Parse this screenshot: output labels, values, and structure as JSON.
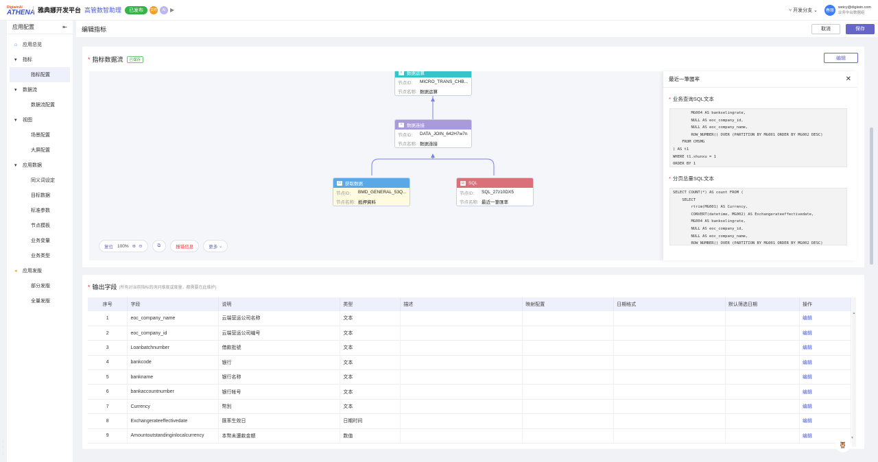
{
  "topbar": {
    "logo_main": "ATHENA",
    "logo_small": "DigiwinAI",
    "platform": "雅典娜开发平台",
    "app_name": "高管数智助理",
    "status": "已发布",
    "av1": "文件",
    "av2": "AI",
    "branch": "开发分支",
    "avatar": "春丽",
    "user_email": "weicy@digiwin.com",
    "user_org": "业务中台数据组"
  },
  "sidebar": {
    "title": "应用配置",
    "items": [
      {
        "label": "应用总览",
        "icon": "home-icon",
        "type": "top",
        "glyph": "⌂"
      },
      {
        "label": "指标",
        "type": "group",
        "glyph": "▾"
      },
      {
        "label": "指标配置",
        "type": "sub",
        "selected": true
      },
      {
        "label": "数据流",
        "type": "group",
        "glyph": "▾"
      },
      {
        "label": "数据流配置",
        "type": "sub"
      },
      {
        "label": "视图",
        "type": "group",
        "glyph": "▾"
      },
      {
        "label": "场景配置",
        "type": "sub"
      },
      {
        "label": "大屏配置",
        "type": "sub"
      },
      {
        "label": "应用数据",
        "type": "group",
        "glyph": "▾"
      },
      {
        "label": "同义词设定",
        "type": "sub"
      },
      {
        "label": "目标数据",
        "type": "sub"
      },
      {
        "label": "标准参数",
        "type": "sub"
      },
      {
        "label": "节点模板",
        "type": "sub"
      },
      {
        "label": "业务变量",
        "type": "sub"
      },
      {
        "label": "业务类型",
        "type": "sub"
      },
      {
        "label": "应用发版",
        "type": "group",
        "glyph": "◂"
      },
      {
        "label": "部分发版",
        "type": "sub"
      },
      {
        "label": "全量发版",
        "type": "sub"
      }
    ]
  },
  "header": {
    "title": "编辑指标",
    "cancel": "取消",
    "save": "保存"
  },
  "flow": {
    "title": "指标数据流",
    "tag": "已保存",
    "edit": "编辑",
    "k_id": "节点ID:",
    "k_name": "节点名称:",
    "nodes": [
      {
        "id": "MICRO_TRANS_CHB...",
        "name": "数据运算",
        "header": "数据运算",
        "color": "#36c3c9",
        "icon": "≡"
      },
      {
        "id": "DATA_JOIN_642H7w7n",
        "name": "数据连接",
        "header": "数据连接",
        "color": "#a99ad9",
        "icon": "⚭"
      },
      {
        "id": "BMD_GENERAL_53Q...",
        "name": "抵押資料",
        "header": "获取数据",
        "color": "#5aa9e6",
        "icon": "⊡"
      },
      {
        "id": "SQL_27z10DX5",
        "name": "最近一筆匯率",
        "header": "SQL",
        "color": "#d9707a",
        "icon": "▤"
      }
    ],
    "toolbar": {
      "reset": "复位",
      "zoom": "100%",
      "error": "报错信息",
      "more": "更多"
    }
  },
  "sql": {
    "title": "最近一筆匯率",
    "label1": "业务查询SQL文本",
    "label2": "分页总量SQL文本",
    "code1": "        MG004 AS bankselingrate,\n        NULL AS eoc_company_id,\n        NULL AS eoc_company_name,\n        ROW_NUMBER() OVER (PARTITION BY MG001 ORDER BY MG002 DESC)\n    FROM CMSMG\n) AS t1\nWHERE t1.shunxu = 1\nORDER BY 1",
    "code2": "SELECT COUNT(*) AS count FROM (\n    SELECT\n        rtrim(MG001) AS Currency,\n        CONVERT(datetime, MG002) AS Exchangerateeffectivedate,\n        MG004 AS bankselingrate,\n        NULL AS eoc_company_id,\n        NULL AS eoc_company_name,\n        ROW_NUMBER() OVER (PARTITION BY MG001 ORDER BY MG002 DESC)"
  },
  "fields": {
    "title": "输出字段",
    "hint": "(所有对当前指标的询问维度或度量，都需要在此维护)",
    "columns": [
      "序号",
      "字段",
      "说明",
      "类型",
      "描述",
      "映射配置",
      "日期格式",
      "默认筛选日期",
      "操作"
    ],
    "rows": [
      [
        "1",
        "eoc_company_name",
        "云端营运公司名称",
        "文本",
        "",
        "",
        "",
        "",
        "编辑"
      ],
      [
        "2",
        "eoc_company_id",
        "云端营运公司编号",
        "文本",
        "",
        "",
        "",
        "",
        "编辑"
      ],
      [
        "3",
        "Loanbatchnumber",
        "借款批號",
        "文本",
        "",
        "",
        "",
        "",
        "编辑"
      ],
      [
        "4",
        "bankcode",
        "银行",
        "文本",
        "",
        "",
        "",
        "",
        "编辑"
      ],
      [
        "5",
        "bankname",
        "银行名称",
        "文本",
        "",
        "",
        "",
        "",
        "编辑"
      ],
      [
        "6",
        "bankaccountnumber",
        "银行帐号",
        "文本",
        "",
        "",
        "",
        "",
        "编辑"
      ],
      [
        "7",
        "Currency",
        "幣別",
        "文本",
        "",
        "",
        "",
        "",
        "编辑"
      ],
      [
        "8",
        "Exchangerateeffectivedate",
        "匯率生效日",
        "日期时间",
        "",
        "",
        "",
        "",
        "编辑"
      ],
      [
        "9",
        "Amountoutstandinginlocalcurrency",
        "本幣未還款金額",
        "数值",
        "",
        "",
        "",
        "",
        "编辑"
      ]
    ]
  }
}
